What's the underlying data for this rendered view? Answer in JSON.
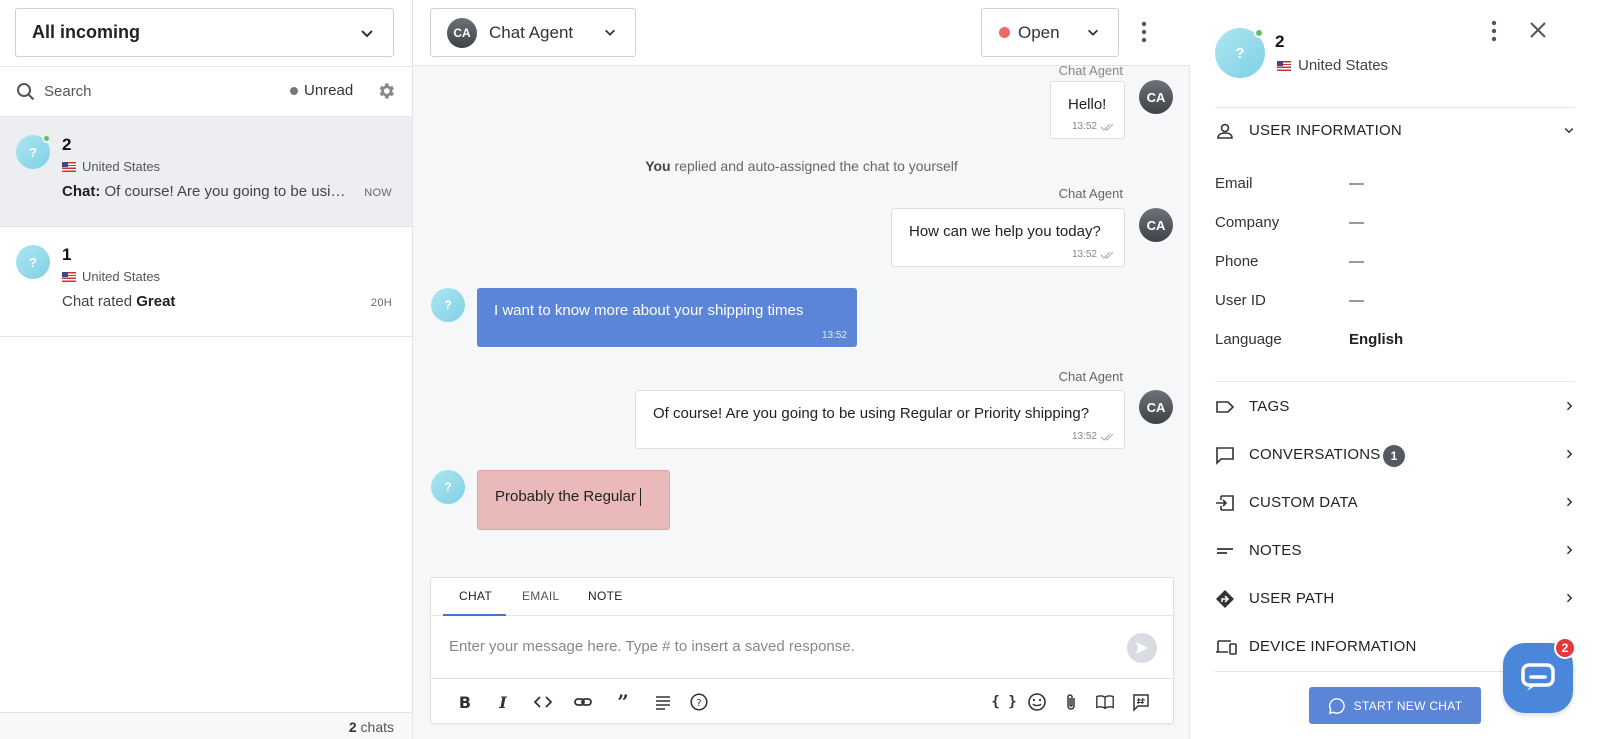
{
  "left": {
    "inbox_select": "All incoming",
    "search_label": "Search",
    "unread_label": "Unread",
    "conversations": [
      {
        "name": "2",
        "location": "United States",
        "preview_prefix": "Chat:",
        "preview": " Of course! Are you going to be using Regular or Priority shipping?",
        "time": "NOW"
      },
      {
        "name": "1",
        "location": "United States",
        "preview_prefix": "Chat rated ",
        "preview": "Great",
        "time": "20H"
      }
    ],
    "footer_count": "2",
    "footer_label": " chats"
  },
  "header": {
    "agent_initials": "CA",
    "agent_name": "Chat Agent",
    "status": "Open"
  },
  "messages": {
    "m1_sender": "Chat Agent",
    "m1_text": "Hello!",
    "m1_time": "13:52",
    "system_you": "You",
    "system_text": " replied and auto-assigned the chat to yourself",
    "m2_sender": "Chat Agent",
    "m2_text": "How can we help you today?",
    "m2_time": "13:52",
    "m3_text": "I want to know more about your shipping times",
    "m3_time": "13:52",
    "m4_sender": "Chat Agent",
    "m4_text": "Of course! Are you going to be using Regular or Priority shipping?",
    "m4_time": "13:52",
    "m5_text": "Probably the Regular",
    "visitor_initial": "?",
    "agent_initials": "CA"
  },
  "composer": {
    "tab_chat": "CHAT",
    "tab_email": "EMAIL",
    "tab_note": "NOTE",
    "placeholder": "Enter your message here. Type # to insert a saved response.",
    "tool_variables": "{ }"
  },
  "right": {
    "name": "2",
    "location": "United States",
    "user_info_label": "USER INFORMATION",
    "fields": [
      {
        "key": "Email",
        "value": "—"
      },
      {
        "key": "Company",
        "value": "—"
      },
      {
        "key": "Phone",
        "value": "—"
      },
      {
        "key": "User ID",
        "value": "—"
      },
      {
        "key": "Language",
        "value": "English"
      }
    ],
    "tags_label": "TAGS",
    "conversations_label": "CONVERSATIONS",
    "conversations_count": "1",
    "custom_data_label": "CUSTOM DATA",
    "notes_label": "NOTES",
    "user_path_label": "USER PATH",
    "device_info_label": "DEVICE INFORMATION",
    "start_chat_label": "START NEW CHAT",
    "launcher_badge": "2"
  },
  "colors": {
    "accent": "#5b85d6",
    "status_open": "#ee6a6a",
    "draft_bubble": "#eab9b9",
    "online": "#55c75f",
    "launcher": "#4a86d9",
    "badge_red": "#e23a3a"
  }
}
